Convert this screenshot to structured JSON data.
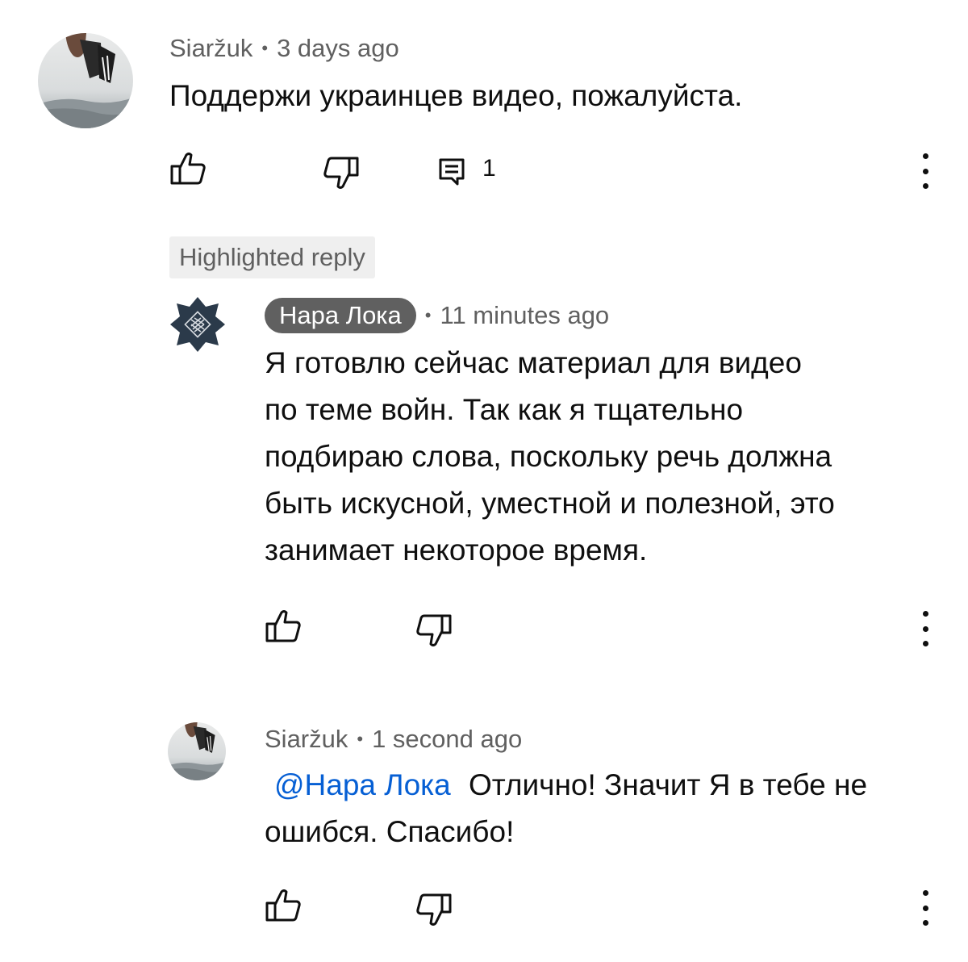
{
  "comment": {
    "author": "Siaržuk",
    "time": "3 days ago",
    "text": "Поддержи украинцев видео, пожалуйста.",
    "reply_count": "1"
  },
  "highlighted_label": "Highlighted reply",
  "reply1": {
    "author": "Нара Лока",
    "time": "11 minutes ago",
    "lines": [
      "Я готовлю сейчас материал для видео",
      "по теме войн. Так как я тщательно",
      "подбираю слова, поскольку речь должна",
      "быть искусной, уместной и полезной, это",
      "занимает некоторое время."
    ]
  },
  "reply2": {
    "author": "Siaržuk",
    "time": "1 second ago",
    "mention": "@Нара Лока",
    "line1": "Отлично! Значит Я в тебе не",
    "line2": "ошибся. Спасибо!"
  },
  "colors": {
    "text_primary": "#0f0f0f",
    "text_secondary": "#606060",
    "mention": "#065fd4",
    "chip_bg": "#efefef",
    "author_chip_bg": "#606060",
    "logo_bg": "#2b3a4a"
  },
  "icons": [
    "like-icon",
    "dislike-icon",
    "replies-icon",
    "more-options-icon"
  ]
}
